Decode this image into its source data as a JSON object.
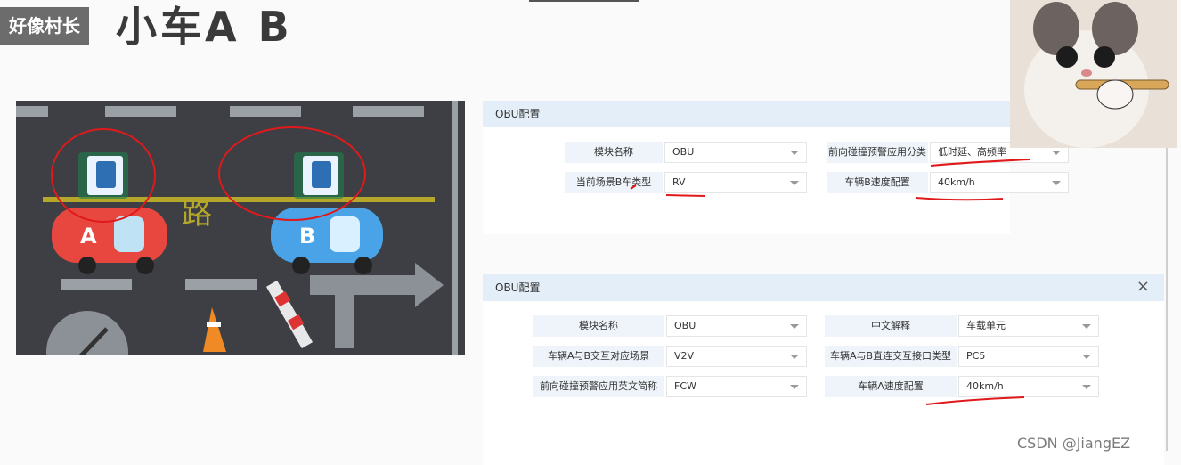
{
  "watermark": {
    "name": "好像村长",
    "title": "小车A B"
  },
  "scene": {
    "car_a": "A",
    "car_b": "B",
    "device_a": "OBU",
    "device_b": "OBU",
    "road_text": "路"
  },
  "panel1": {
    "title": "OBU配置",
    "rows": [
      {
        "label": "模块名称",
        "value": "OBU"
      },
      {
        "label": "前向碰撞预警应用分类",
        "value": "低时延、高频率"
      },
      {
        "label": "当前场景B车类型",
        "value": "RV"
      },
      {
        "label": "车辆B速度配置",
        "value": "40km/h"
      }
    ]
  },
  "panel2": {
    "title": "OBU配置",
    "close": "×",
    "rows": [
      {
        "label": "模块名称",
        "value": "OBU"
      },
      {
        "label": "中文解释",
        "value": "车载单元"
      },
      {
        "label": "车辆A与B交互对应场景",
        "value": "V2V"
      },
      {
        "label": "车辆A与B直连交互接口类型",
        "value": "PC5"
      },
      {
        "label": "前向碰撞预警应用英文简称",
        "value": "FCW"
      },
      {
        "label": "车辆A速度配置",
        "value": "40km/h"
      }
    ]
  },
  "footer": {
    "csdn": "CSDN @JiangEZ"
  },
  "colors": {
    "panel_header": "#e3eef8",
    "label_bg": "#eef4fa",
    "annotation_red": "#e0191b",
    "car_a": "#e8473f",
    "car_b": "#4aa3e6",
    "road": "#3d3f44"
  }
}
